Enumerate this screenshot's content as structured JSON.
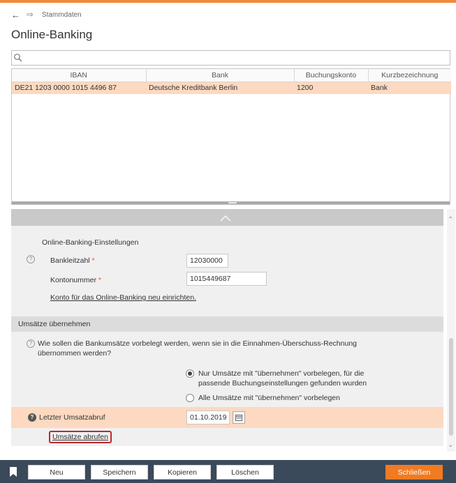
{
  "nav": {
    "back_icon": "arrow-left-icon",
    "forward_icon": "arrow-right-icon",
    "breadcrumb": "Stammdaten"
  },
  "page_title": "Online-Banking",
  "search": {
    "value": "",
    "placeholder": ""
  },
  "table": {
    "headers": [
      "IBAN",
      "Bank",
      "Buchungskonto",
      "Kurzbezeichnung"
    ],
    "rows": [
      [
        "DE21 1203 0000 1015 4496 87",
        "Deutsche Kreditbank Berlin",
        "1200",
        "Bank"
      ]
    ]
  },
  "settings": {
    "ghost_label": "",
    "title": "Online-Banking-Einstellungen",
    "bankleitzahl_label": "Bankleitzahl",
    "bankleitzahl_value": "12030000",
    "kontonummer_label": "Kontonummer",
    "kontonummer_value": "1015449687",
    "required_mark": "*",
    "setup_link": "Konto für das Online-Banking neu einrichten."
  },
  "umsaetze": {
    "title": "Umsätze übernehmen",
    "question": "Wie sollen die Bankumsätze vorbelegt werden, wenn sie in die Einnahmen-Überschuss-Rechnung übernommen werden?",
    "option1": "Nur Umsätze mit \"übernehmen\" vorbelegen, für die passende Buchungseinstellungen gefunden wurden",
    "option2": "Alle Umsätze mit \"übernehmen\" vorbelegen",
    "selected_option": 1,
    "last_fetch_label": "Letzter Umsatzabruf",
    "last_fetch_date": "01.10.2019",
    "fetch_link": "Umsätze abrufen"
  },
  "footer": {
    "new": "Neu",
    "save": "Speichern",
    "copy": "Kopieren",
    "delete": "Löschen",
    "close": "Schließen"
  },
  "colors": {
    "accent": "#f07b22",
    "highlight": "#fcd9c0",
    "footer_bg": "#3b4a5a",
    "link_box": "#c0272d"
  }
}
